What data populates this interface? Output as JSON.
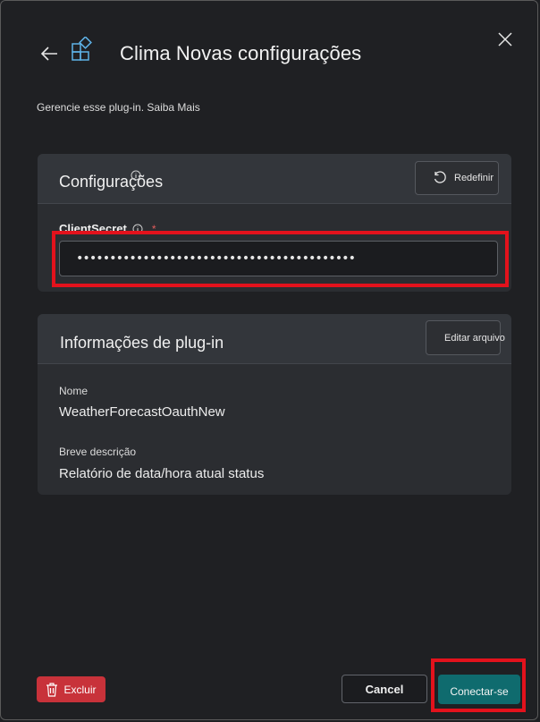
{
  "header": {
    "title": "Clima Novas configurações",
    "subtitle": "Gerencie esse plug-in. Saiba Mais",
    "back_icon": "arrow-left-icon",
    "app_icon": "apps-add-icon",
    "close_icon": "close-icon"
  },
  "settings_card": {
    "title": "Configurações",
    "reset_label": "Redefinir",
    "field_label": "ClientSecret",
    "required_mark": "*",
    "secret_value": "••••••••••••••••••••••••••••••••••••••••••"
  },
  "plugin_card": {
    "title": "Informações de plug-in",
    "edit_label": "Editar arquivo",
    "name_label": "Nome",
    "name_value": "WeatherForecastOauthNew",
    "desc_label": "Breve descrição",
    "desc_value": "Relatório de data/hora atual status"
  },
  "footer": {
    "delete_label": "Excluir",
    "cancel_label": "Cancel",
    "connect_label": "Conectar-se"
  },
  "colors": {
    "accent": "#0f6b6e",
    "danger": "#c8323a",
    "highlight": "#e3121c"
  }
}
